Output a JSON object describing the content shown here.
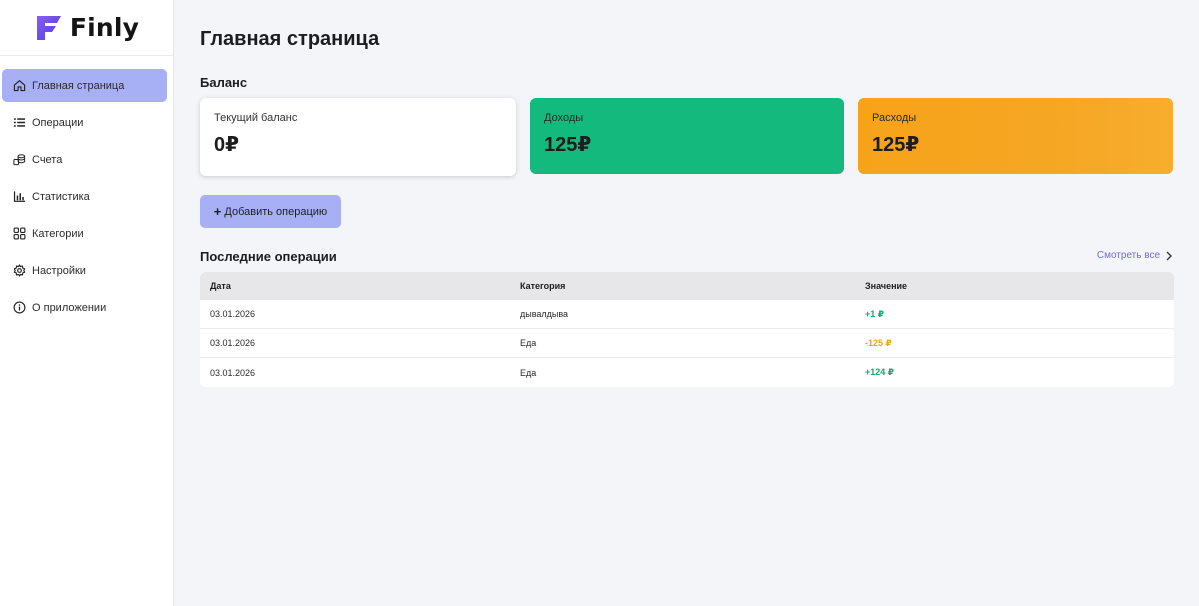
{
  "app": {
    "name": "Finly"
  },
  "sidebar": {
    "items": [
      {
        "label": "Главная страница",
        "icon": "home-icon",
        "active": true
      },
      {
        "label": "Операции",
        "icon": "list-icon"
      },
      {
        "label": "Счета",
        "icon": "coins-icon"
      },
      {
        "label": "Статистика",
        "icon": "bar-chart-icon"
      },
      {
        "label": "Категории",
        "icon": "grid-icon"
      },
      {
        "label": "Настройки",
        "icon": "gear-icon"
      },
      {
        "label": "О приложении",
        "icon": "info-icon"
      }
    ]
  },
  "main": {
    "title": "Главная страница",
    "balance_section": "Баланс",
    "cards": {
      "balance": {
        "label": "Текущий баланс",
        "value": "0₽"
      },
      "income": {
        "label": "Доходы",
        "value": "125₽"
      },
      "expense": {
        "label": "Расходы",
        "value": "125₽"
      }
    },
    "add_button": {
      "plus": "+",
      "label": "Добавить операцию"
    },
    "recent": {
      "title": "Последние операции",
      "see_all": "Смотреть все",
      "columns": [
        "Дата",
        "Категория",
        "Значение"
      ],
      "rows": [
        {
          "date": "03.01.2026",
          "category": "дывалдыва",
          "value": "+1 ₽",
          "type": "income"
        },
        {
          "date": "03.01.2026",
          "category": "Еда",
          "value": "-125 ₽",
          "type": "expense"
        },
        {
          "date": "03.01.2026",
          "category": "Еда",
          "value": "+124 ₽",
          "type": "income"
        }
      ]
    }
  },
  "colors": {
    "accent": "#a7b0f4",
    "income": "#13b97d",
    "expense": "#f5a623",
    "link": "#6b6fd6"
  }
}
